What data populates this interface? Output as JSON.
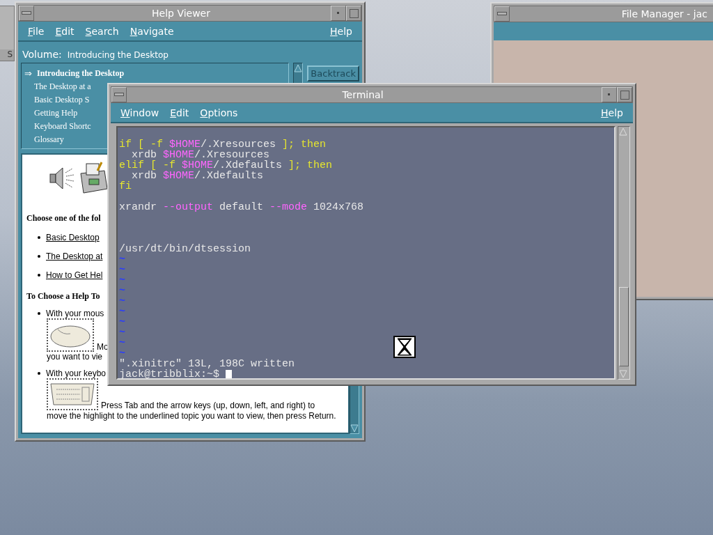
{
  "front_panel": {
    "label": "S"
  },
  "file_manager": {
    "title": "File Manager - jac"
  },
  "help_viewer": {
    "title": "Help Viewer",
    "menu": [
      {
        "label": "File"
      },
      {
        "label": "Edit"
      },
      {
        "label": "Search"
      },
      {
        "label": "Navigate"
      }
    ],
    "help_menu": "Help",
    "volume_label": "Volume:",
    "volume": "Introducing the Desktop",
    "marker": "⇒",
    "topics": [
      {
        "text": "Introducing the Desktop",
        "selected": true
      },
      {
        "text": "The Desktop at a",
        "selected": false
      },
      {
        "text": "Basic Desktop S",
        "selected": false
      },
      {
        "text": "Getting Help",
        "selected": false
      },
      {
        "text": "Keyboard Shortc",
        "selected": false
      },
      {
        "text": "Glossary",
        "selected": false
      }
    ],
    "backtrack": "Backtrack",
    "content": {
      "heading1": "Choose one of the fol",
      "links": [
        "Basic Desktop",
        "The Desktop at",
        "How to Get Hel"
      ],
      "heading2": "To Choose a Help To",
      "mouse_item": {
        "first": "With your mous",
        "after_image": "Mo",
        "last": "you want to vie"
      },
      "keyboard_item": {
        "first": "With your keybo",
        "after_image": "Press Tab and the arrow keys (up, down, left, and right) to",
        "rest": "move the highlight to the underlined topic you want to view, then press Return."
      }
    }
  },
  "terminal": {
    "title": "Terminal",
    "menu": [
      {
        "label": "Window"
      },
      {
        "label": "Edit"
      },
      {
        "label": "Options"
      }
    ],
    "help_menu": "Help",
    "lines": [
      {
        "kind": "text",
        "segments": [
          {
            "kind": "keyword",
            "text": "if [ -f "
          },
          {
            "kind": "variable",
            "text": "$HOME"
          },
          {
            "kind": "plain",
            "text": "/.Xresources "
          },
          {
            "kind": "keyword",
            "text": "]; then"
          }
        ]
      },
      {
        "kind": "text",
        "segments": [
          {
            "kind": "plain",
            "text": "  xrdb "
          },
          {
            "kind": "variable",
            "text": "$HOME"
          },
          {
            "kind": "plain",
            "text": "/.Xresources"
          }
        ]
      },
      {
        "kind": "text",
        "segments": [
          {
            "kind": "keyword",
            "text": "elif [ -f "
          },
          {
            "kind": "variable",
            "text": "$HOME"
          },
          {
            "kind": "plain",
            "text": "/.Xdefaults "
          },
          {
            "kind": "keyword",
            "text": "]; then"
          }
        ]
      },
      {
        "kind": "text",
        "segments": [
          {
            "kind": "plain",
            "text": "  xrdb "
          },
          {
            "kind": "variable",
            "text": "$HOME"
          },
          {
            "kind": "plain",
            "text": "/.Xdefaults"
          }
        ]
      },
      {
        "kind": "text",
        "segments": [
          {
            "kind": "keyword",
            "text": "fi"
          }
        ]
      },
      {
        "kind": "blank"
      },
      {
        "kind": "text",
        "segments": [
          {
            "kind": "plain",
            "text": "xrandr "
          },
          {
            "kind": "variable",
            "text": "--output"
          },
          {
            "kind": "plain",
            "text": " default "
          },
          {
            "kind": "variable",
            "text": "--mode"
          },
          {
            "kind": "plain",
            "text": " 1024x768"
          }
        ]
      },
      {
        "kind": "blank"
      },
      {
        "kind": "blank"
      },
      {
        "kind": "blank"
      },
      {
        "kind": "text",
        "segments": [
          {
            "kind": "plain",
            "text": "/usr/dt/bin/dtsession"
          }
        ]
      },
      {
        "kind": "text",
        "segments": [
          {
            "kind": "tilde",
            "text": "~"
          }
        ]
      },
      {
        "kind": "text",
        "segments": [
          {
            "kind": "tilde",
            "text": "~"
          }
        ]
      },
      {
        "kind": "text",
        "segments": [
          {
            "kind": "tilde",
            "text": "~"
          }
        ]
      },
      {
        "kind": "text",
        "segments": [
          {
            "kind": "tilde",
            "text": "~"
          }
        ]
      },
      {
        "kind": "text",
        "segments": [
          {
            "kind": "tilde",
            "text": "~"
          }
        ]
      },
      {
        "kind": "text",
        "segments": [
          {
            "kind": "tilde",
            "text": "~"
          }
        ]
      },
      {
        "kind": "text",
        "segments": [
          {
            "kind": "tilde",
            "text": "~"
          }
        ]
      },
      {
        "kind": "text",
        "segments": [
          {
            "kind": "tilde",
            "text": "~"
          }
        ]
      },
      {
        "kind": "text",
        "segments": [
          {
            "kind": "tilde",
            "text": "~"
          }
        ]
      },
      {
        "kind": "text",
        "segments": [
          {
            "kind": "tilde",
            "text": "~"
          }
        ]
      },
      {
        "kind": "text",
        "segments": [
          {
            "kind": "plain",
            "text": "\".xinitrc\" 13L, 198C written"
          }
        ]
      },
      {
        "kind": "text",
        "cursor": true,
        "segments": [
          {
            "kind": "plain",
            "text": "jack@tribblix:~$ "
          }
        ]
      }
    ]
  }
}
